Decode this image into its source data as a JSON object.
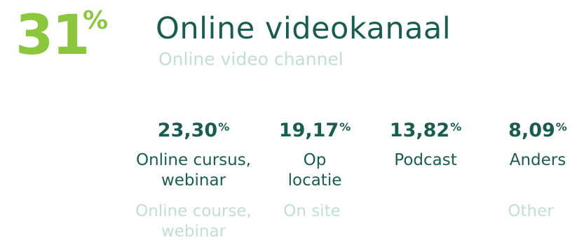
{
  "headline": {
    "value": "31",
    "percent_sign": "%",
    "title": "Online videokanaal",
    "subtitle": "Online video channel"
  },
  "stats": [
    {
      "value": "23,30",
      "percent_sign": "%",
      "label_line1": "Online cursus,",
      "label_line2": "webinar",
      "en_line1": "Online course,",
      "en_line2": "webinar"
    },
    {
      "value": "19,17",
      "percent_sign": "%",
      "label_line1": "Op",
      "label_line2": "locatie",
      "en_line1": "On site",
      "en_line2": ""
    },
    {
      "value": "13,82",
      "percent_sign": "%",
      "label_line1": "Podcast",
      "label_line2": "",
      "en_line1": "",
      "en_line2": ""
    },
    {
      "value": "8,09",
      "percent_sign": "%",
      "label_line1": "Anders",
      "label_line2": "",
      "en_line1": "Other",
      "en_line2": ""
    }
  ],
  "colors": {
    "accent_green": "#8cc63f",
    "dark_teal": "#1a5c4f",
    "light_teal": "#c3ddd3"
  }
}
